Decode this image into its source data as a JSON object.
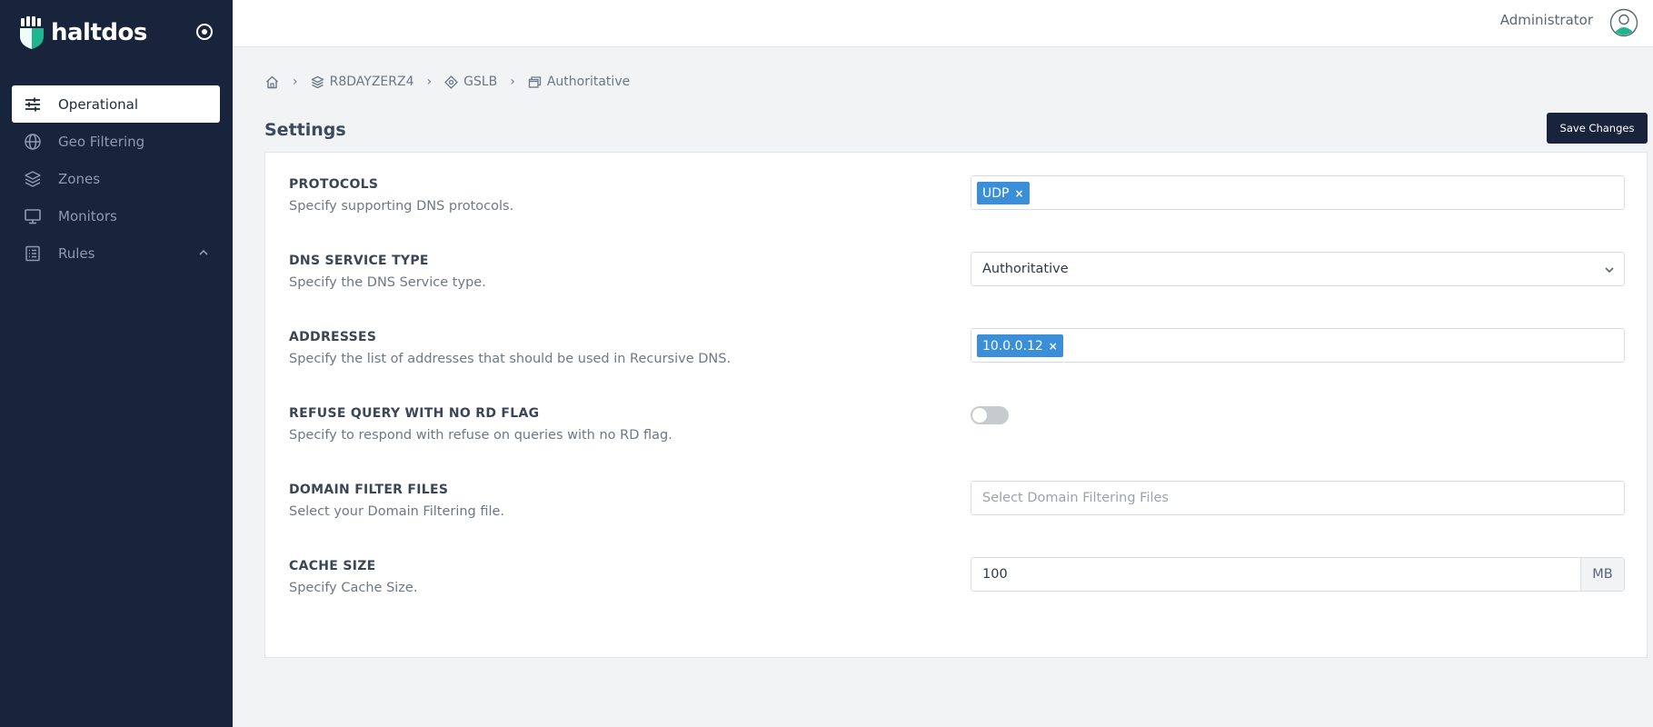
{
  "brand": {
    "name": "haltdos"
  },
  "sidebar": {
    "items": [
      {
        "label": "Operational",
        "icon": "sliders-icon",
        "active": true
      },
      {
        "label": "Geo Filtering",
        "icon": "globe-icon"
      },
      {
        "label": "Zones",
        "icon": "layers-icon"
      },
      {
        "label": "Monitors",
        "icon": "monitor-icon"
      },
      {
        "label": "Rules",
        "icon": "list-icon",
        "expandable": true
      }
    ]
  },
  "header": {
    "user": "Administrator"
  },
  "breadcrumb": [
    {
      "label": "",
      "icon": "home-icon"
    },
    {
      "label": "R8DAYZERZ4",
      "icon": "layers-icon"
    },
    {
      "label": "GSLB",
      "icon": "crosshair-icon"
    },
    {
      "label": "Authoritative",
      "icon": "windows-icon"
    }
  ],
  "page": {
    "title": "Settings",
    "save_label": "Save Changes"
  },
  "settings": {
    "protocols": {
      "label": "PROTOCOLS",
      "desc": "Specify supporting DNS protocols.",
      "tags": [
        "UDP"
      ]
    },
    "service_type": {
      "label": "DNS SERVICE TYPE",
      "desc": "Specify the DNS Service type.",
      "value": "Authoritative"
    },
    "addresses": {
      "label": "ADDRESSES",
      "desc": "Specify the list of addresses that should be used in Recursive DNS.",
      "tags": [
        "10.0.0.12"
      ]
    },
    "refuse_query": {
      "label": "REFUSE QUERY WITH NO RD FLAG",
      "desc": "Specify to respond with refuse on queries with no RD flag.",
      "enabled": false
    },
    "domain_filter": {
      "label": "DOMAIN FILTER FILES",
      "desc": "Select your Domain Filtering file.",
      "placeholder": "Select Domain Filtering Files"
    },
    "cache_size": {
      "label": "CACHE SIZE",
      "desc": "Specify Cache Size.",
      "value": "100",
      "unit": "MB"
    }
  },
  "colors": {
    "sidebar_bg": "#17243b",
    "tag_bg": "#3b8fd9",
    "logo_accent": "#1fb58f"
  }
}
